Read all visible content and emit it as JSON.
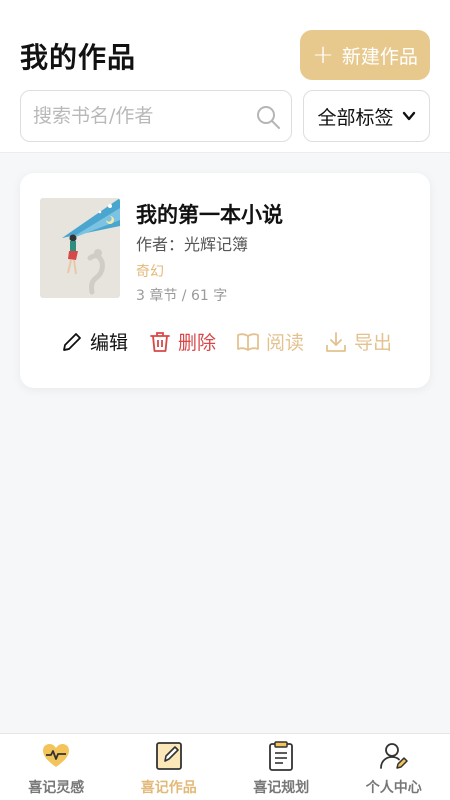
{
  "header": {
    "title": "我的作品",
    "new_button": "新建作品",
    "search_placeholder": "搜索书名/作者",
    "tag_select": "全部标签"
  },
  "works": [
    {
      "title": "我的第一本小说",
      "author": "作者：光辉记簿",
      "tag": "奇幻",
      "stats": "3 章节 / 61 字"
    }
  ],
  "card_actions": {
    "edit": "编辑",
    "delete": "删除",
    "read": "阅读",
    "export": "导出"
  },
  "tabbar": {
    "items": [
      {
        "label": "喜记灵感",
        "icon": "heartbeat-icon"
      },
      {
        "label": "喜记作品",
        "icon": "edit-document-icon",
        "active": true
      },
      {
        "label": "喜记规划",
        "icon": "clipboard-icon"
      },
      {
        "label": "个人中心",
        "icon": "user-icon"
      }
    ]
  },
  "colors": {
    "accent": "#e8c98d",
    "accent_text": "#e3b97a",
    "danger": "#d94848"
  }
}
